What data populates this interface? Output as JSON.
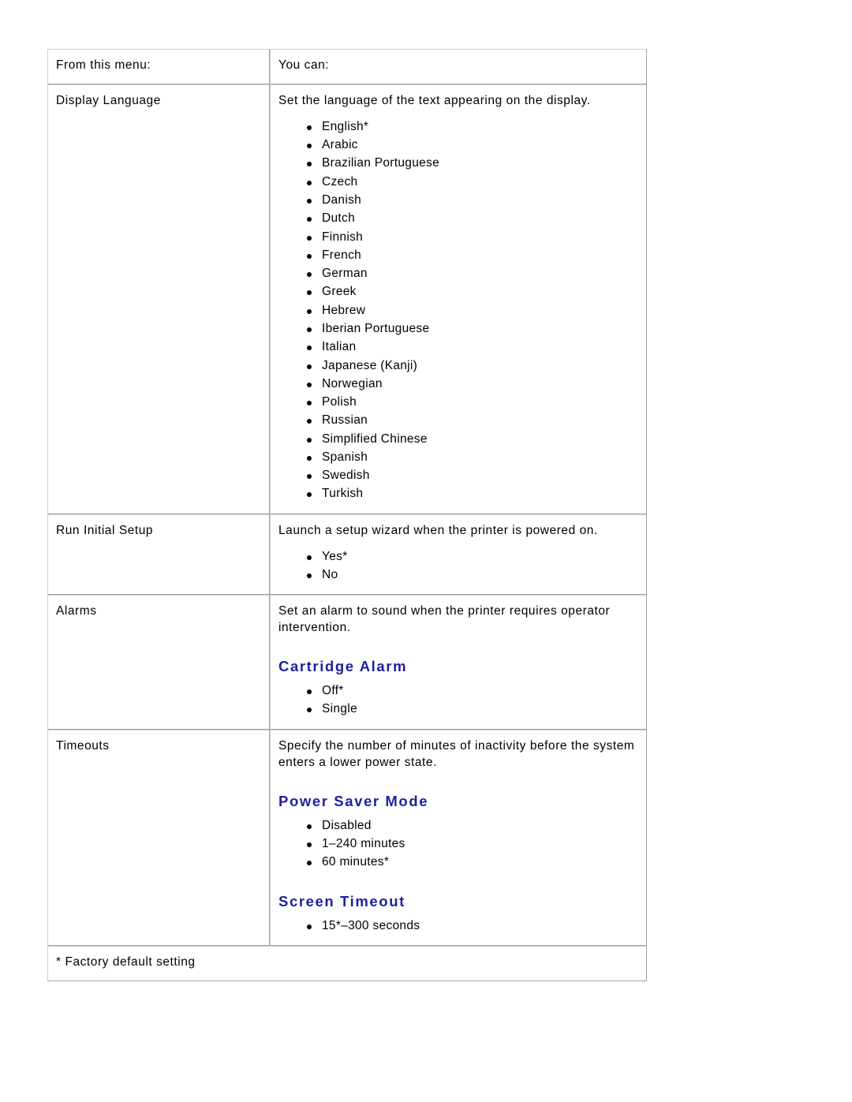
{
  "document": {
    "type": "printer-settings-reference-table",
    "footnote": "* Factory default setting"
  },
  "table": {
    "headers": {
      "col1": "From this menu:",
      "col2": "You can:"
    },
    "rows": [
      {
        "menu": "Display Language",
        "description": "Set the language of the text appearing on the display.",
        "sections": [
          {
            "heading": null,
            "options": [
              "English*",
              "Arabic",
              "Brazilian Portuguese",
              "Czech",
              "Danish",
              "Dutch",
              "Finnish",
              "French",
              "German",
              "Greek",
              "Hebrew",
              "Iberian Portuguese",
              "Italian",
              "Japanese (Kanji)",
              "Norwegian",
              "Polish",
              "Russian",
              "Simplified Chinese",
              "Spanish",
              "Swedish",
              "Turkish"
            ]
          }
        ]
      },
      {
        "menu": "Run Initial Setup",
        "description": "Launch a setup wizard when the printer is powered on.",
        "sections": [
          {
            "heading": null,
            "options": [
              "Yes*",
              "No"
            ]
          }
        ]
      },
      {
        "menu": "Alarms",
        "description": "Set an alarm to sound when the printer requires operator intervention.",
        "sections": [
          {
            "heading": "Cartridge Alarm",
            "options": [
              "Off*",
              "Single"
            ]
          }
        ]
      },
      {
        "menu": "Timeouts",
        "description": "Specify the number of minutes of inactivity before the system enters a lower power state.",
        "sections": [
          {
            "heading": "Power Saver Mode",
            "options": [
              "Disabled",
              "1–240 minutes",
              "60 minutes*"
            ]
          },
          {
            "heading": "Screen Timeout",
            "options": [
              "15*–300 seconds"
            ]
          }
        ]
      }
    ]
  },
  "colors": {
    "heading_blue": "#1f1fa0",
    "border_gray": "#a0a0a0",
    "text_black": "#000000",
    "page_background": "#ffffff"
  }
}
